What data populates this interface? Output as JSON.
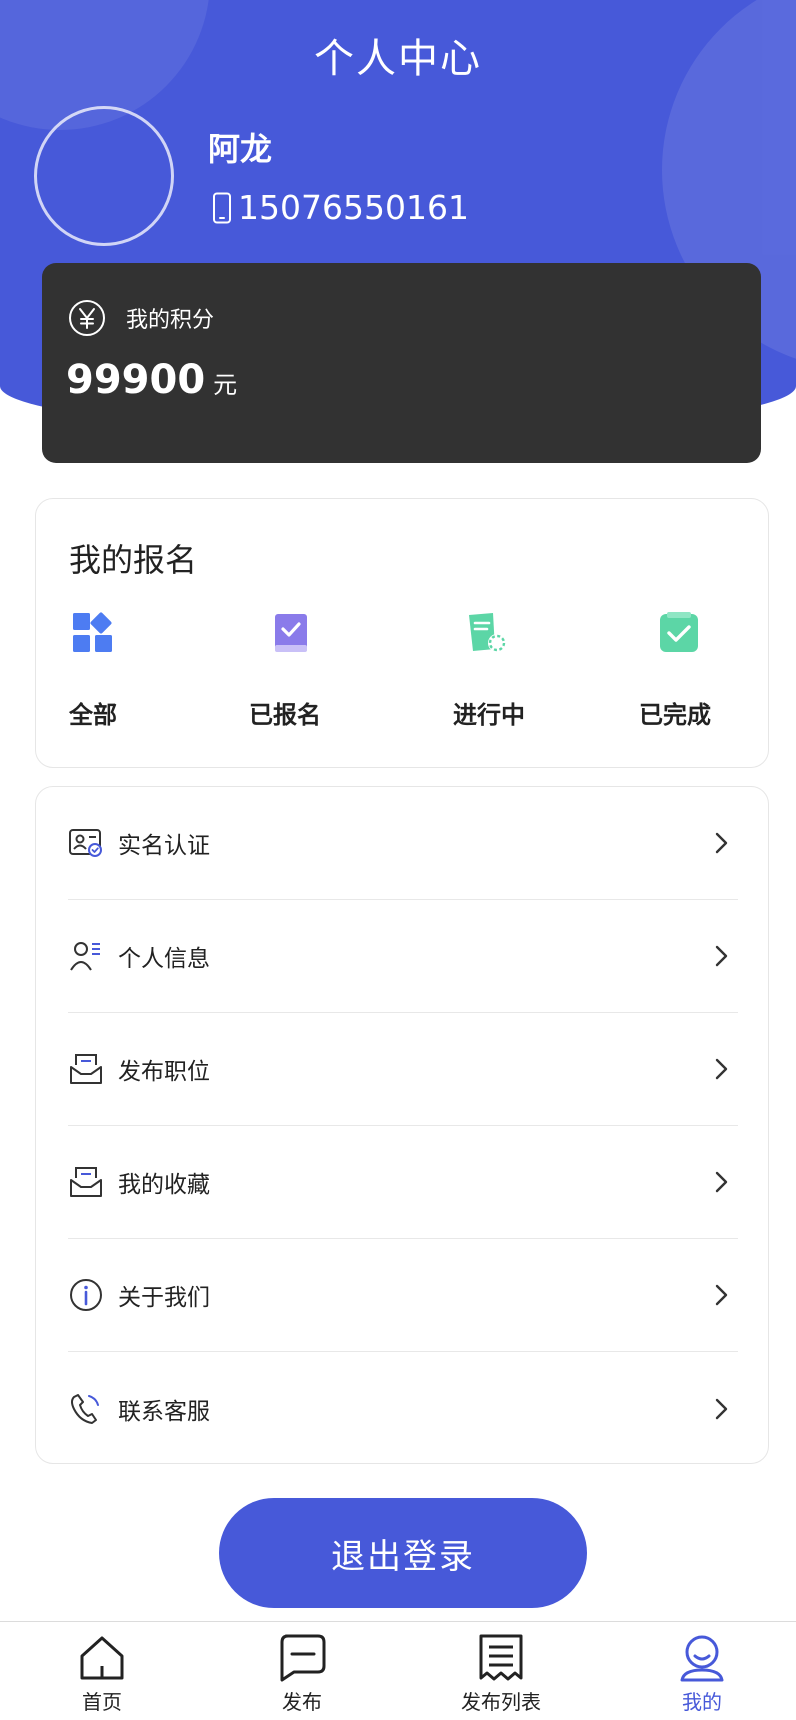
{
  "header": {
    "title": "个人中心",
    "user_name": "阿龙",
    "phone": "15076550161",
    "icons": {
      "phone": "phone-icon",
      "yen": "yen-circle-icon"
    }
  },
  "points": {
    "label": "我的积分",
    "value": "99900",
    "unit": "元"
  },
  "registration": {
    "title": "我的报名",
    "items": [
      {
        "label": "全部",
        "icon": "grid-shapes-icon",
        "color": "#4d7cf2"
      },
      {
        "label": "已报名",
        "icon": "book-check-icon",
        "color": "#8a7bea"
      },
      {
        "label": "进行中",
        "icon": "document-progress-icon",
        "color": "#5cd6a6"
      },
      {
        "label": "已完成",
        "icon": "clipboard-check-icon",
        "color": "#5cd6a6"
      }
    ]
  },
  "menu": {
    "items": [
      {
        "label": "实名认证",
        "icon": "id-card-icon"
      },
      {
        "label": "个人信息",
        "icon": "user-info-icon"
      },
      {
        "label": "发布职位",
        "icon": "inbox-tray-icon"
      },
      {
        "label": "我的收藏",
        "icon": "inbox-tray-icon"
      },
      {
        "label": "关于我们",
        "icon": "info-circle-icon"
      },
      {
        "label": "联系客服",
        "icon": "phone-call-icon"
      }
    ]
  },
  "logout": {
    "label": "退出登录"
  },
  "tabbar": {
    "items": [
      {
        "label": "首页",
        "icon": "home-icon"
      },
      {
        "label": "发布",
        "icon": "message-icon"
      },
      {
        "label": "发布列表",
        "icon": "receipt-list-icon"
      },
      {
        "label": "我的",
        "icon": "user-profile-icon",
        "active": true
      }
    ]
  },
  "colors": {
    "brand": "#4759d9",
    "card_dark": "#323232",
    "text": "#222222",
    "active_tab": "#4759d9"
  }
}
